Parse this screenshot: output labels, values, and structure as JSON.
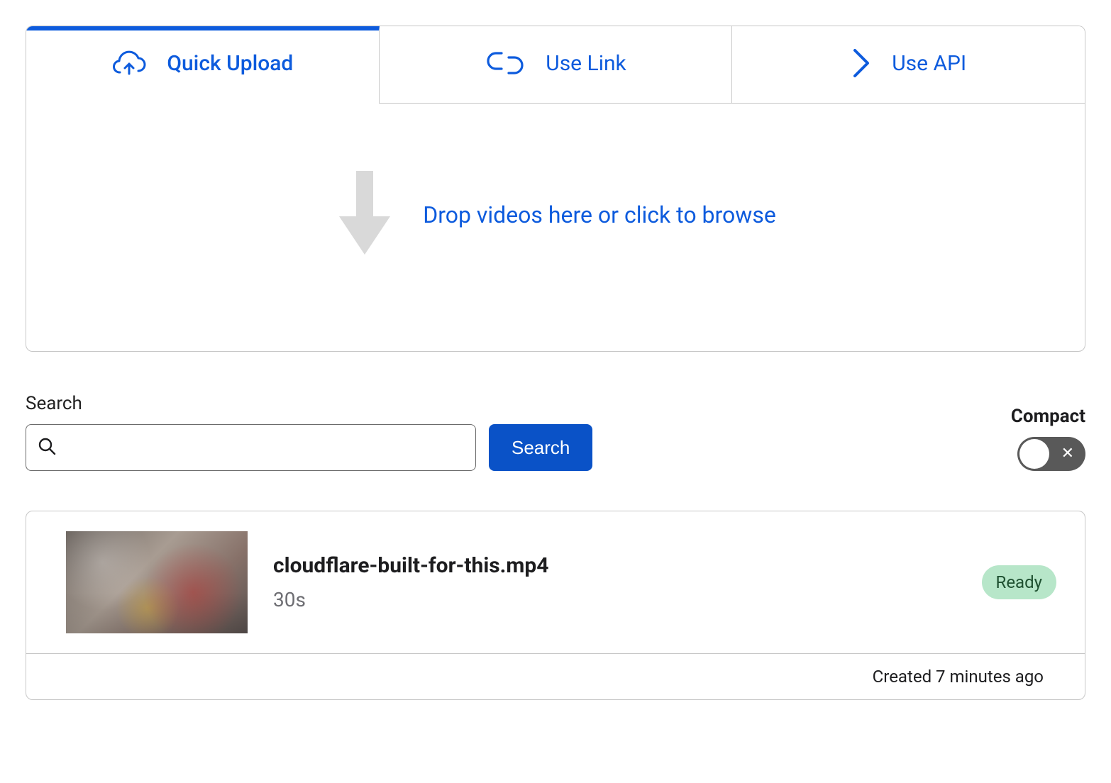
{
  "tabs": [
    {
      "label": "Quick Upload",
      "icon": "cloud-upload-icon",
      "active": true
    },
    {
      "label": "Use Link",
      "icon": "link-icon",
      "active": false
    },
    {
      "label": "Use API",
      "icon": "chevron-right-icon",
      "active": false
    }
  ],
  "dropzone": {
    "text": "Drop videos here or click to browse"
  },
  "search": {
    "label": "Search",
    "placeholder": "",
    "button_label": "Search"
  },
  "compact": {
    "label": "Compact",
    "enabled": false
  },
  "videos": [
    {
      "title": "cloudflare-built-for-this.mp4",
      "duration": "30s",
      "status": "Ready",
      "created_text": "Created 7 minutes ago"
    }
  ]
}
